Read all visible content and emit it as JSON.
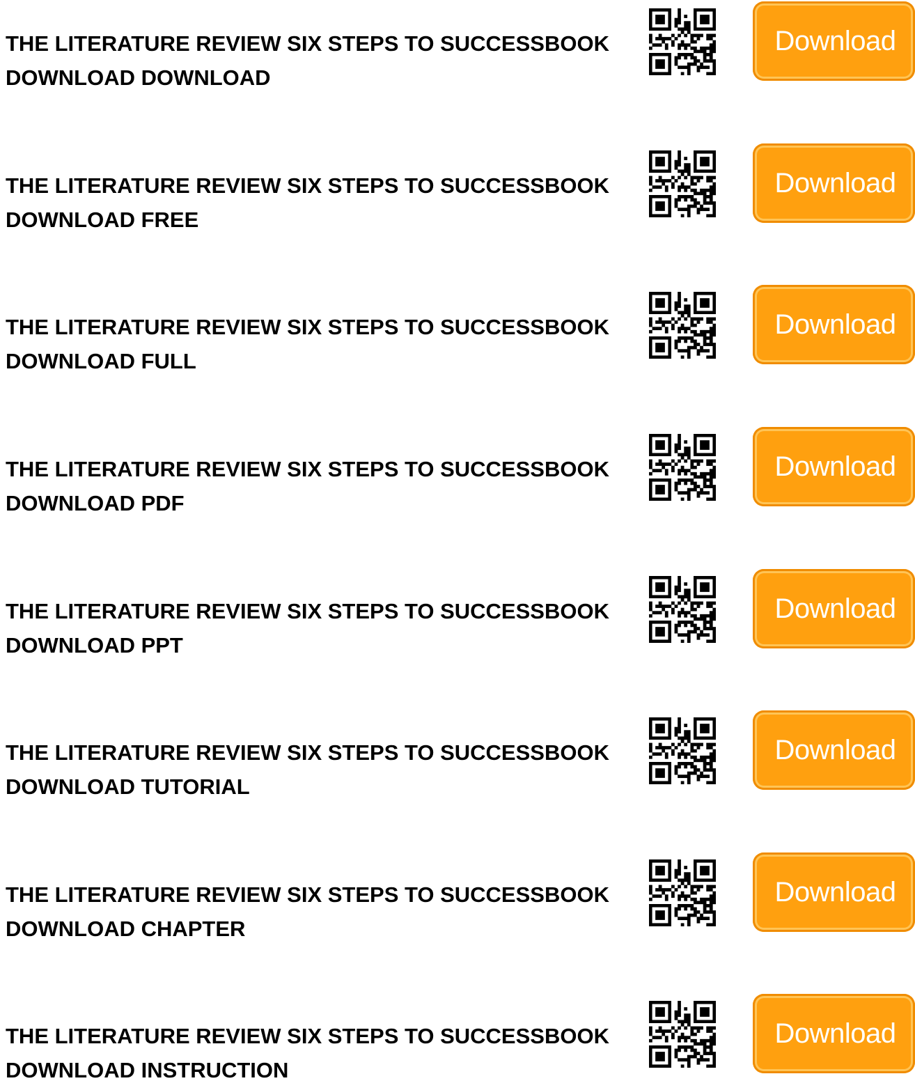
{
  "items": [
    {
      "title_line1": "THE LITERATURE REVIEW SIX STEPS TO SUCCESSBOOK",
      "title_line2": "DOWNLOAD DOWNLOAD",
      "button_label": "Download"
    },
    {
      "title_line1": "THE LITERATURE REVIEW SIX STEPS TO SUCCESSBOOK",
      "title_line2": "DOWNLOAD FREE",
      "button_label": "Download"
    },
    {
      "title_line1": "THE LITERATURE REVIEW SIX STEPS TO SUCCESSBOOK",
      "title_line2": "DOWNLOAD FULL",
      "button_label": "Download"
    },
    {
      "title_line1": "THE LITERATURE REVIEW SIX STEPS TO SUCCESSBOOK",
      "title_line2": "DOWNLOAD PDF",
      "button_label": "Download"
    },
    {
      "title_line1": "THE LITERATURE REVIEW SIX STEPS TO SUCCESSBOOK",
      "title_line2": "DOWNLOAD PPT",
      "button_label": "Download"
    },
    {
      "title_line1": "THE LITERATURE REVIEW SIX STEPS TO SUCCESSBOOK",
      "title_line2": "DOWNLOAD TUTORIAL",
      "button_label": "Download"
    },
    {
      "title_line1": "THE LITERATURE REVIEW SIX STEPS TO SUCCESSBOOK",
      "title_line2": "DOWNLOAD CHAPTER",
      "button_label": "Download"
    },
    {
      "title_line1": "THE LITERATURE REVIEW SIX STEPS TO SUCCESSBOOK",
      "title_line2": "DOWNLOAD INSTRUCTION",
      "button_label": "Download"
    }
  ],
  "icons": {
    "qr": "qr-code-icon"
  },
  "colors": {
    "button_fill": "#ffa00f",
    "button_text": "#ffffff",
    "title_text": "#000000"
  }
}
